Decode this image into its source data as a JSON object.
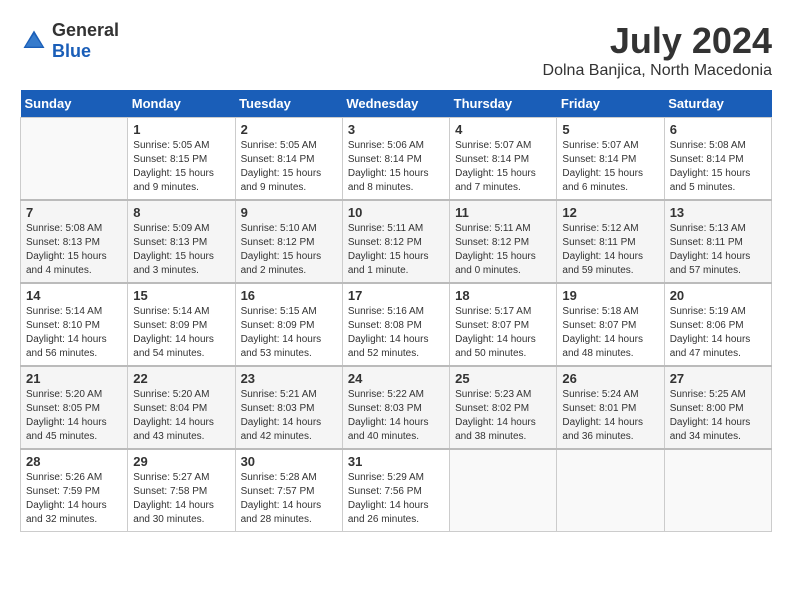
{
  "logo": {
    "general": "General",
    "blue": "Blue"
  },
  "header": {
    "title": "July 2024",
    "subtitle": "Dolna Banjica, North Macedonia"
  },
  "weekdays": [
    "Sunday",
    "Monday",
    "Tuesday",
    "Wednesday",
    "Thursday",
    "Friday",
    "Saturday"
  ],
  "weeks": [
    [
      {
        "day": "",
        "sunrise": "",
        "sunset": "",
        "daylight": ""
      },
      {
        "day": "1",
        "sunrise": "Sunrise: 5:05 AM",
        "sunset": "Sunset: 8:15 PM",
        "daylight": "Daylight: 15 hours and 9 minutes."
      },
      {
        "day": "2",
        "sunrise": "Sunrise: 5:05 AM",
        "sunset": "Sunset: 8:14 PM",
        "daylight": "Daylight: 15 hours and 9 minutes."
      },
      {
        "day": "3",
        "sunrise": "Sunrise: 5:06 AM",
        "sunset": "Sunset: 8:14 PM",
        "daylight": "Daylight: 15 hours and 8 minutes."
      },
      {
        "day": "4",
        "sunrise": "Sunrise: 5:07 AM",
        "sunset": "Sunset: 8:14 PM",
        "daylight": "Daylight: 15 hours and 7 minutes."
      },
      {
        "day": "5",
        "sunrise": "Sunrise: 5:07 AM",
        "sunset": "Sunset: 8:14 PM",
        "daylight": "Daylight: 15 hours and 6 minutes."
      },
      {
        "day": "6",
        "sunrise": "Sunrise: 5:08 AM",
        "sunset": "Sunset: 8:14 PM",
        "daylight": "Daylight: 15 hours and 5 minutes."
      }
    ],
    [
      {
        "day": "7",
        "sunrise": "Sunrise: 5:08 AM",
        "sunset": "Sunset: 8:13 PM",
        "daylight": "Daylight: 15 hours and 4 minutes."
      },
      {
        "day": "8",
        "sunrise": "Sunrise: 5:09 AM",
        "sunset": "Sunset: 8:13 PM",
        "daylight": "Daylight: 15 hours and 3 minutes."
      },
      {
        "day": "9",
        "sunrise": "Sunrise: 5:10 AM",
        "sunset": "Sunset: 8:12 PM",
        "daylight": "Daylight: 15 hours and 2 minutes."
      },
      {
        "day": "10",
        "sunrise": "Sunrise: 5:11 AM",
        "sunset": "Sunset: 8:12 PM",
        "daylight": "Daylight: 15 hours and 1 minute."
      },
      {
        "day": "11",
        "sunrise": "Sunrise: 5:11 AM",
        "sunset": "Sunset: 8:12 PM",
        "daylight": "Daylight: 15 hours and 0 minutes."
      },
      {
        "day": "12",
        "sunrise": "Sunrise: 5:12 AM",
        "sunset": "Sunset: 8:11 PM",
        "daylight": "Daylight: 14 hours and 59 minutes."
      },
      {
        "day": "13",
        "sunrise": "Sunrise: 5:13 AM",
        "sunset": "Sunset: 8:11 PM",
        "daylight": "Daylight: 14 hours and 57 minutes."
      }
    ],
    [
      {
        "day": "14",
        "sunrise": "Sunrise: 5:14 AM",
        "sunset": "Sunset: 8:10 PM",
        "daylight": "Daylight: 14 hours and 56 minutes."
      },
      {
        "day": "15",
        "sunrise": "Sunrise: 5:14 AM",
        "sunset": "Sunset: 8:09 PM",
        "daylight": "Daylight: 14 hours and 54 minutes."
      },
      {
        "day": "16",
        "sunrise": "Sunrise: 5:15 AM",
        "sunset": "Sunset: 8:09 PM",
        "daylight": "Daylight: 14 hours and 53 minutes."
      },
      {
        "day": "17",
        "sunrise": "Sunrise: 5:16 AM",
        "sunset": "Sunset: 8:08 PM",
        "daylight": "Daylight: 14 hours and 52 minutes."
      },
      {
        "day": "18",
        "sunrise": "Sunrise: 5:17 AM",
        "sunset": "Sunset: 8:07 PM",
        "daylight": "Daylight: 14 hours and 50 minutes."
      },
      {
        "day": "19",
        "sunrise": "Sunrise: 5:18 AM",
        "sunset": "Sunset: 8:07 PM",
        "daylight": "Daylight: 14 hours and 48 minutes."
      },
      {
        "day": "20",
        "sunrise": "Sunrise: 5:19 AM",
        "sunset": "Sunset: 8:06 PM",
        "daylight": "Daylight: 14 hours and 47 minutes."
      }
    ],
    [
      {
        "day": "21",
        "sunrise": "Sunrise: 5:20 AM",
        "sunset": "Sunset: 8:05 PM",
        "daylight": "Daylight: 14 hours and 45 minutes."
      },
      {
        "day": "22",
        "sunrise": "Sunrise: 5:20 AM",
        "sunset": "Sunset: 8:04 PM",
        "daylight": "Daylight: 14 hours and 43 minutes."
      },
      {
        "day": "23",
        "sunrise": "Sunrise: 5:21 AM",
        "sunset": "Sunset: 8:03 PM",
        "daylight": "Daylight: 14 hours and 42 minutes."
      },
      {
        "day": "24",
        "sunrise": "Sunrise: 5:22 AM",
        "sunset": "Sunset: 8:03 PM",
        "daylight": "Daylight: 14 hours and 40 minutes."
      },
      {
        "day": "25",
        "sunrise": "Sunrise: 5:23 AM",
        "sunset": "Sunset: 8:02 PM",
        "daylight": "Daylight: 14 hours and 38 minutes."
      },
      {
        "day": "26",
        "sunrise": "Sunrise: 5:24 AM",
        "sunset": "Sunset: 8:01 PM",
        "daylight": "Daylight: 14 hours and 36 minutes."
      },
      {
        "day": "27",
        "sunrise": "Sunrise: 5:25 AM",
        "sunset": "Sunset: 8:00 PM",
        "daylight": "Daylight: 14 hours and 34 minutes."
      }
    ],
    [
      {
        "day": "28",
        "sunrise": "Sunrise: 5:26 AM",
        "sunset": "Sunset: 7:59 PM",
        "daylight": "Daylight: 14 hours and 32 minutes."
      },
      {
        "day": "29",
        "sunrise": "Sunrise: 5:27 AM",
        "sunset": "Sunset: 7:58 PM",
        "daylight": "Daylight: 14 hours and 30 minutes."
      },
      {
        "day": "30",
        "sunrise": "Sunrise: 5:28 AM",
        "sunset": "Sunset: 7:57 PM",
        "daylight": "Daylight: 14 hours and 28 minutes."
      },
      {
        "day": "31",
        "sunrise": "Sunrise: 5:29 AM",
        "sunset": "Sunset: 7:56 PM",
        "daylight": "Daylight: 14 hours and 26 minutes."
      },
      {
        "day": "",
        "sunrise": "",
        "sunset": "",
        "daylight": ""
      },
      {
        "day": "",
        "sunrise": "",
        "sunset": "",
        "daylight": ""
      },
      {
        "day": "",
        "sunrise": "",
        "sunset": "",
        "daylight": ""
      }
    ]
  ]
}
